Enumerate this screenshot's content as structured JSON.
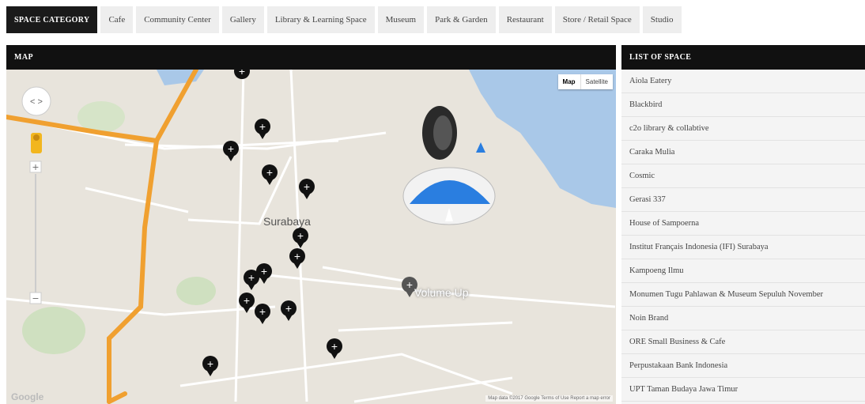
{
  "category_tabs": [
    {
      "label": "SPACE CATEGORY",
      "active": true
    },
    {
      "label": "Cafe",
      "active": false
    },
    {
      "label": "Community Center",
      "active": false
    },
    {
      "label": "Gallery",
      "active": false
    },
    {
      "label": "Library & Learning Space",
      "active": false
    },
    {
      "label": "Museum",
      "active": false
    },
    {
      "label": "Park & Garden",
      "active": false
    },
    {
      "label": "Restaurant",
      "active": false
    },
    {
      "label": "Store / Retail Space",
      "active": false
    },
    {
      "label": "Studio",
      "active": false
    }
  ],
  "map_panel": {
    "header": "MAP",
    "map_type": {
      "map": "Map",
      "satellite": "Satellite"
    },
    "city_label": "Surabaya",
    "overlay_text": "Volume Up",
    "google_logo": "Google",
    "attribution": "Map data ©2017 Google   Terms of Use   Report a map error"
  },
  "list_panel": {
    "header": "LIST OF SPACE",
    "items": [
      "Aiola Eatery",
      "Blackbird",
      "c2o library & collabtive",
      "Caraka Mulia",
      "Cosmic",
      "Gerasi 337",
      "House of Sampoerna",
      "Institut Français Indonesia (IFI) Surabaya",
      "Kampoeng Ilmu",
      "Monumen Tugu Pahlawan & Museum Sepuluh November",
      "Noin Brand",
      "ORE Small Business & Cafe",
      "Perpustakaan Bank Indonesia",
      "UPT Taman Budaya Jawa Timur"
    ]
  },
  "colors": {
    "header_bg": "#111111",
    "highway": "#f0a030",
    "sea": "#a9c8e8",
    "overlay_arrow": "#2a7ee0"
  }
}
